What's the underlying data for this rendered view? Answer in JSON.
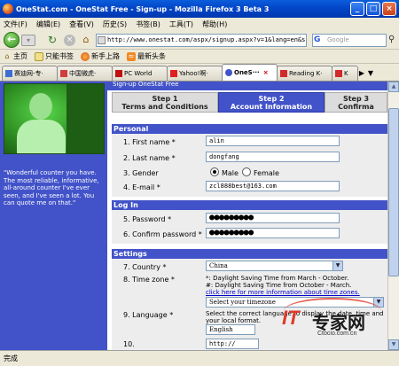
{
  "window": {
    "title": "OneStat.com - OneStat Free - Sign-up - Mozilla Firefox 3 Beta 3",
    "minimize": "_",
    "maximize": "□",
    "close": "×"
  },
  "menu": [
    "文件(F)",
    "编辑(E)",
    "查看(V)",
    "历史(S)",
    "书签(B)",
    "工具(T)",
    "帮助(H)"
  ],
  "nav": {
    "url": "http://www.onestat.com/aspx/signup.aspx?v=1&lang=en&s",
    "search_placeholder": "Google",
    "search_engine_icon": "G"
  },
  "bookmarks": [
    {
      "label": "主页",
      "icon": "home-icon"
    },
    {
      "label": "只能书签",
      "icon": "bookmark-icon"
    },
    {
      "label": "新手上路",
      "icon": "firefox-icon"
    },
    {
      "label": "最新头条",
      "icon": "rss-icon"
    }
  ],
  "tabs": [
    {
      "label": "赛迪网-专·",
      "active": false
    },
    {
      "label": "中国微虎·",
      "active": false
    },
    {
      "label": "PC World",
      "active": false
    },
    {
      "label": "Yahoo!啊·",
      "active": false
    },
    {
      "label": "OneS···",
      "active": true
    },
    {
      "label": "Reading K·",
      "active": false
    },
    {
      "label": "K",
      "active": false
    }
  ],
  "sidebar": {
    "quote": "\"Wonderful counter you have. The most reliable, informative, all-around counter I've ever seen, and I've seen a lot. You can quote me on that.\""
  },
  "page": {
    "header_strip": "Sign-up OneStat Free",
    "steps": [
      {
        "num": "Step 1",
        "label": "Terms and Conditions"
      },
      {
        "num": "Step 2",
        "label": "Account Information"
      },
      {
        "num": "Step 3",
        "label": "Confirma"
      }
    ],
    "personal": {
      "title": "Personal",
      "first_name_label": "1. First name *",
      "first_name": "alin",
      "last_name_label": "2. Last name *",
      "last_name": "dongfang",
      "gender_label": "3. Gender",
      "male": "Male",
      "female": "Female",
      "email_label": "4. E-mail *",
      "email": "zcl888best@163.com"
    },
    "login": {
      "title": "Log In",
      "password_label": "5. Password *",
      "password": "●●●●●●●●●",
      "confirm_label": "6. Confirm password *",
      "confirm": "●●●●●●●●●"
    },
    "settings": {
      "title": "Settings",
      "country_label": "7. Country *",
      "country": "China",
      "timezone_label": "8. Time zone *",
      "tz_note1": "*: Daylight Saving Time from March - October.",
      "tz_note2": "#: Daylight Saving Time from October - March.",
      "tz_link": "click here for more information about time zones.",
      "timezone_value": "Select your timezone",
      "language_label": "9. Language *",
      "lang_note1": "Select the correct language to display the date, time and",
      "lang_note2": "your local format.",
      "language_value": "English",
      "next_label": "10. ",
      "next_value": "http://"
    }
  },
  "status": "完成",
  "watermark": {
    "it": "IT",
    "cn": "专家网",
    "url": "Ctocio.com.cn"
  }
}
